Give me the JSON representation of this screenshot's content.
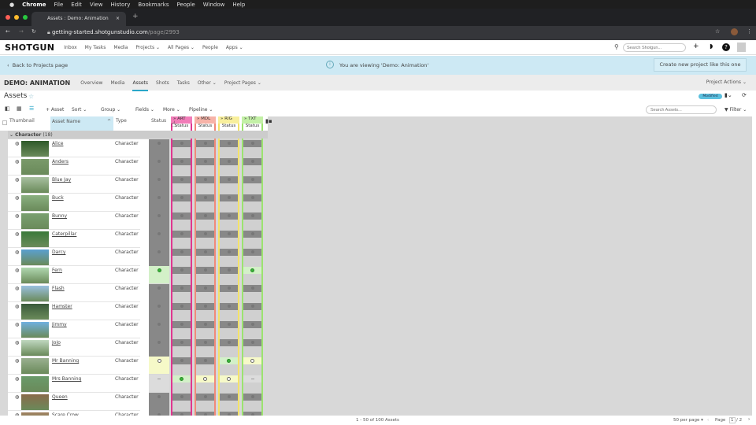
{
  "menubar": {
    "items": [
      "Chrome",
      "File",
      "Edit",
      "View",
      "History",
      "Bookmarks",
      "People",
      "Window",
      "Help"
    ]
  },
  "browser": {
    "tab_title": "Assets : Demo: Animation",
    "url_host": "getting-started.shotgunstudio.com",
    "url_path": "/page/2993"
  },
  "nav": {
    "logo": "SHOTGUN",
    "items": [
      "Inbox",
      "My Tasks",
      "Media",
      "Projects ⌄",
      "All Pages ⌄",
      "People",
      "Apps ⌄"
    ],
    "search_placeholder": "Search Shotgun..."
  },
  "banner": {
    "back": "Back to Projects page",
    "message": "You are viewing 'Demo: Animation'",
    "create_button": "Create new project like this one"
  },
  "project": {
    "title": "DEMO: ANIMATION",
    "tabs": [
      "Overview",
      "Media",
      "Assets",
      "Shots",
      "Tasks",
      "Other ⌄",
      "Project Pages ⌄"
    ],
    "active_tab": "Assets",
    "actions": "Project Actions ⌄"
  },
  "page": {
    "title": "Assets",
    "modified_badge": "Modified",
    "search_placeholder": "Search Assets...",
    "filter": "Filter ⌄"
  },
  "toolbar": {
    "items": [
      "+ Asset",
      "Sort ⌄",
      "Group ⌄",
      "Fields ⌄",
      "More ⌄",
      "Pipeline ⌄"
    ]
  },
  "columns": {
    "thumbnail": "Thumbnail",
    "name": "Asset Name",
    "type": "Type",
    "status": "Status",
    "steps": [
      {
        "name": "ART",
        "sub": "Status",
        "color": "#e0368f",
        "bg": "#f17cb8"
      },
      {
        "name": "MDL",
        "sub": "Status",
        "color": "#f08a7a",
        "bg": "#f7b3a8"
      },
      {
        "name": "RIG",
        "sub": "Status",
        "color": "#f3e26a",
        "bg": "#f8ef9c"
      },
      {
        "name": "TXT",
        "sub": "Status",
        "color": "#9be36f",
        "bg": "#c3f0a6"
      }
    ]
  },
  "group": {
    "label": "Character",
    "count": "(18)"
  },
  "rows": [
    {
      "name": "Alice",
      "type": "Character",
      "status": "na",
      "steps": [
        "na",
        "na",
        "na",
        "na"
      ]
    },
    {
      "name": "Anders",
      "type": "Character",
      "status": "na",
      "steps": [
        "na",
        "na",
        "na",
        "na"
      ]
    },
    {
      "name": "Blue Jay",
      "type": "Character",
      "status": "na",
      "steps": [
        "na",
        "na",
        "na",
        "na"
      ]
    },
    {
      "name": "Buck",
      "type": "Character",
      "status": "na",
      "steps": [
        "na",
        "na",
        "na",
        "na"
      ]
    },
    {
      "name": "Bunny",
      "type": "Character",
      "status": "na",
      "steps": [
        "na",
        "na",
        "na",
        "na"
      ]
    },
    {
      "name": "Caterpillar",
      "type": "Character",
      "status": "na",
      "steps": [
        "na",
        "na",
        "na",
        "na"
      ]
    },
    {
      "name": "Darcy",
      "type": "Character",
      "status": "na",
      "steps": [
        "na",
        "na",
        "na",
        "na"
      ]
    },
    {
      "name": "Fern",
      "type": "Character",
      "status": "fin",
      "steps": [
        "na",
        "na",
        "na",
        "fin"
      ]
    },
    {
      "name": "Flash",
      "type": "Character",
      "status": "na",
      "steps": [
        "na",
        "na",
        "na",
        "na"
      ]
    },
    {
      "name": "Hamster",
      "type": "Character",
      "status": "na",
      "steps": [
        "na",
        "na",
        "na",
        "na"
      ]
    },
    {
      "name": "Jimmy",
      "type": "Character",
      "status": "na",
      "steps": [
        "na",
        "na",
        "na",
        "na"
      ]
    },
    {
      "name": "JoJo",
      "type": "Character",
      "status": "na",
      "steps": [
        "na",
        "na",
        "na",
        "na"
      ]
    },
    {
      "name": "Mr Banning",
      "type": "Character",
      "status": "ip",
      "steps": [
        "na",
        "na",
        "fin",
        "ip"
      ]
    },
    {
      "name": "Mrs Banning",
      "type": "Character",
      "status": "none",
      "steps": [
        "fin",
        "ip",
        "ip",
        "none"
      ]
    },
    {
      "name": "Queen",
      "type": "Character",
      "status": "na",
      "steps": [
        "na",
        "na",
        "na",
        "na"
      ]
    },
    {
      "name": "Scare Crow",
      "type": "Character",
      "status": "na",
      "steps": [
        "na",
        "na",
        "na",
        "na"
      ]
    }
  ],
  "footer": {
    "range": "1 - 50 of 100 Assets",
    "per_page": "50 per page ▾",
    "page_label": "Page",
    "page": "1",
    "total": "/ 2"
  }
}
